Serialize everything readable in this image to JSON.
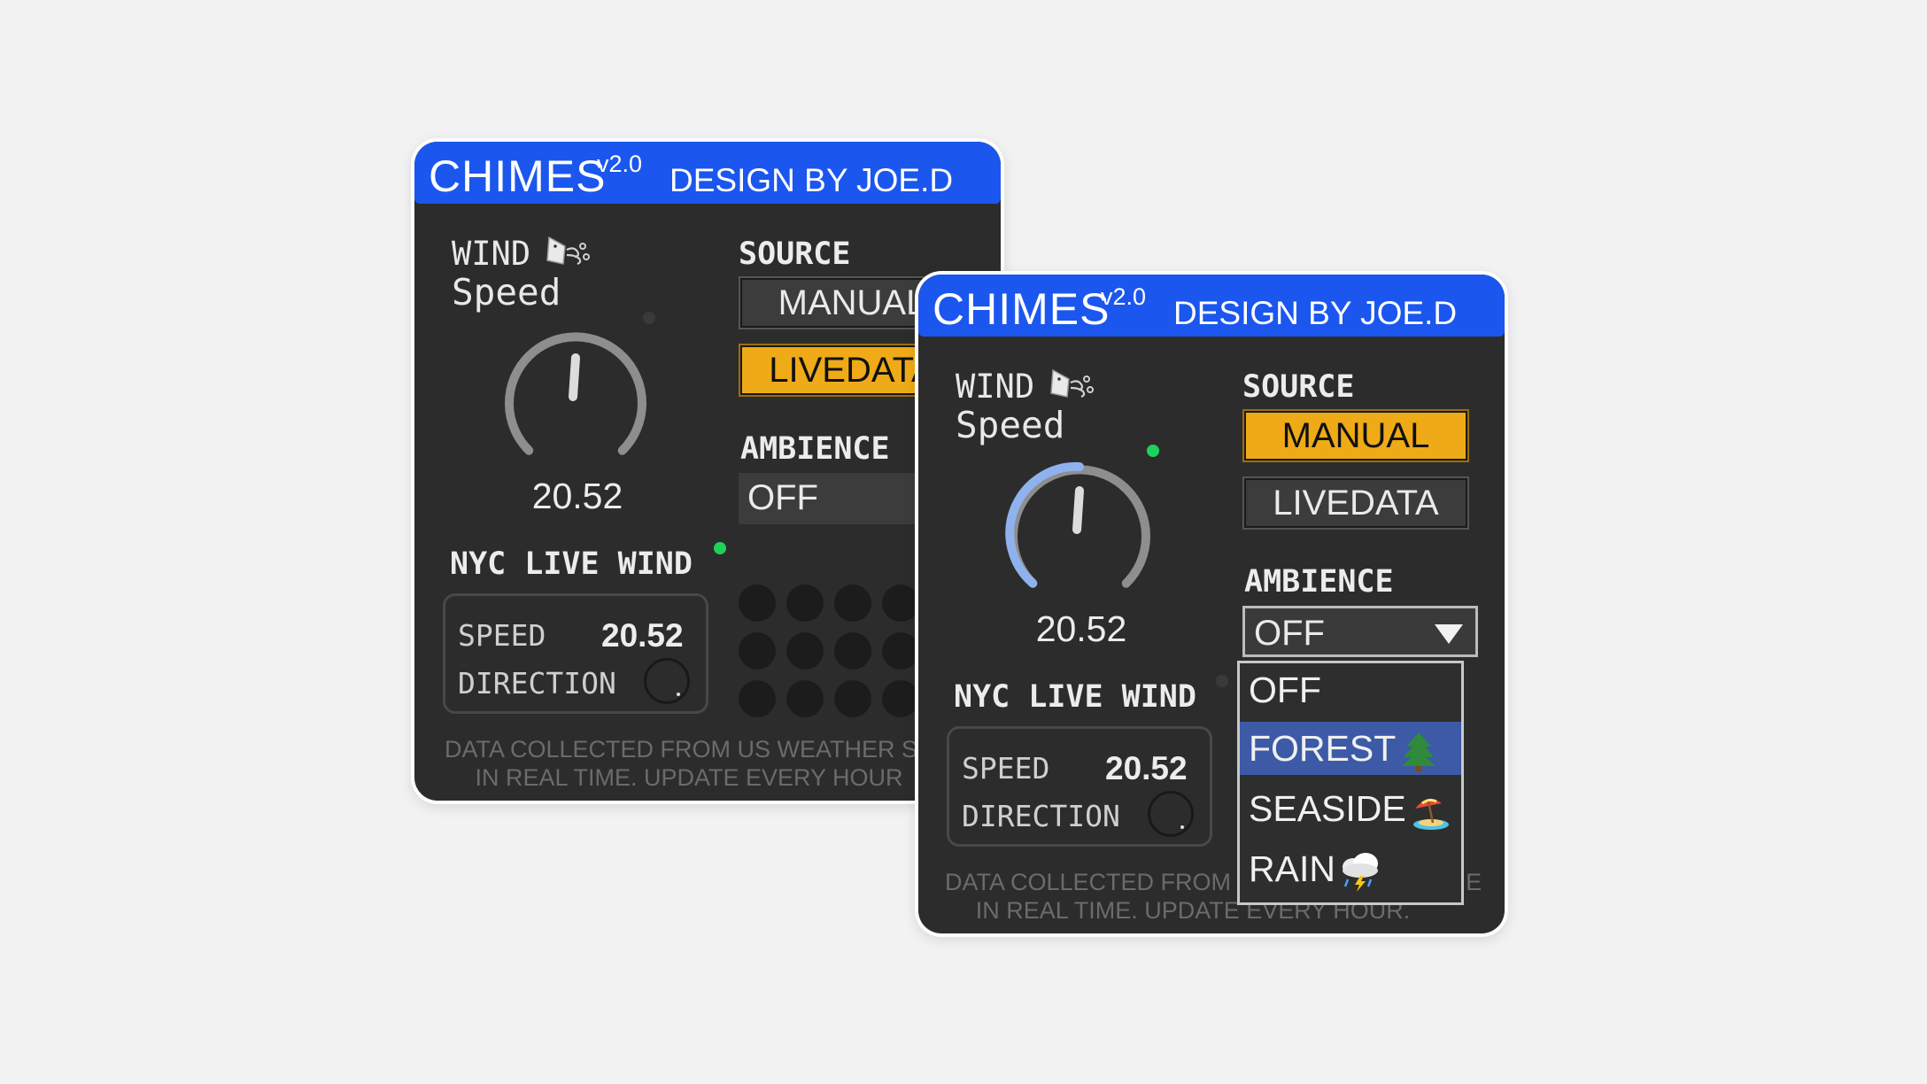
{
  "plugins": [
    {
      "id": "back",
      "app": {
        "title": "CHIMES",
        "version": "v2.0",
        "byline": "DESIGN BY JOE.D"
      },
      "wind": {
        "label": "WIND",
        "icon": "wind-face-icon",
        "speed_label": "Speed",
        "value": "20.52",
        "knob_level": 0.5,
        "led_on": false
      },
      "source": {
        "label": "SOURCE",
        "options": [
          "MANUAL",
          "LIVEDATA"
        ],
        "selected": "LIVEDATA"
      },
      "ambience": {
        "label": "AMBIENCE",
        "value": "OFF",
        "open": false
      },
      "nyc": {
        "label": "NYC LIVE WIND",
        "speed_key": "SPEED",
        "speed_value": "20.52",
        "direction_key": "DIRECTION",
        "led_on": true
      },
      "footer": {
        "line1": "DATA COLLECTED FROM US WEATHER SE",
        "line2": "IN REAL TIME. UPDATE EVERY HOUR"
      }
    },
    {
      "id": "front",
      "app": {
        "title": "CHIMES",
        "version": "v2.0",
        "byline": "DESIGN BY JOE.D"
      },
      "wind": {
        "label": "WIND",
        "icon": "wind-face-icon",
        "speed_label": "Speed",
        "value": "20.52",
        "knob_level": 0.5,
        "led_on": true
      },
      "source": {
        "label": "SOURCE",
        "options": [
          "MANUAL",
          "LIVEDATA"
        ],
        "selected": "MANUAL"
      },
      "ambience": {
        "label": "AMBIENCE",
        "value": "OFF",
        "open": true,
        "options": [
          {
            "label": "OFF",
            "emoji": ""
          },
          {
            "label": "FOREST",
            "emoji": "evergreen-tree-icon"
          },
          {
            "label": "SEASIDE",
            "emoji": "beach-umbrella-icon"
          },
          {
            "label": "RAIN",
            "emoji": "storm-cloud-icon"
          }
        ],
        "highlighted": "FOREST"
      },
      "nyc": {
        "label": "NYC LIVE WIND",
        "speed_key": "SPEED",
        "speed_value": "20.52",
        "direction_key": "DIRECTION",
        "led_on": false
      },
      "footer": {
        "line1": "DATA COLLECTED FROM",
        "line1_tail": "E",
        "line2": "IN REAL TIME. UPDATE EVERY HOUR."
      }
    }
  ],
  "colors": {
    "header_blue": "#1b57ee",
    "panel_dark": "#2c2c2c",
    "active_orange": "#efaa17",
    "led_green": "#1fd15a",
    "highlight_blue": "#3c5aa6"
  }
}
